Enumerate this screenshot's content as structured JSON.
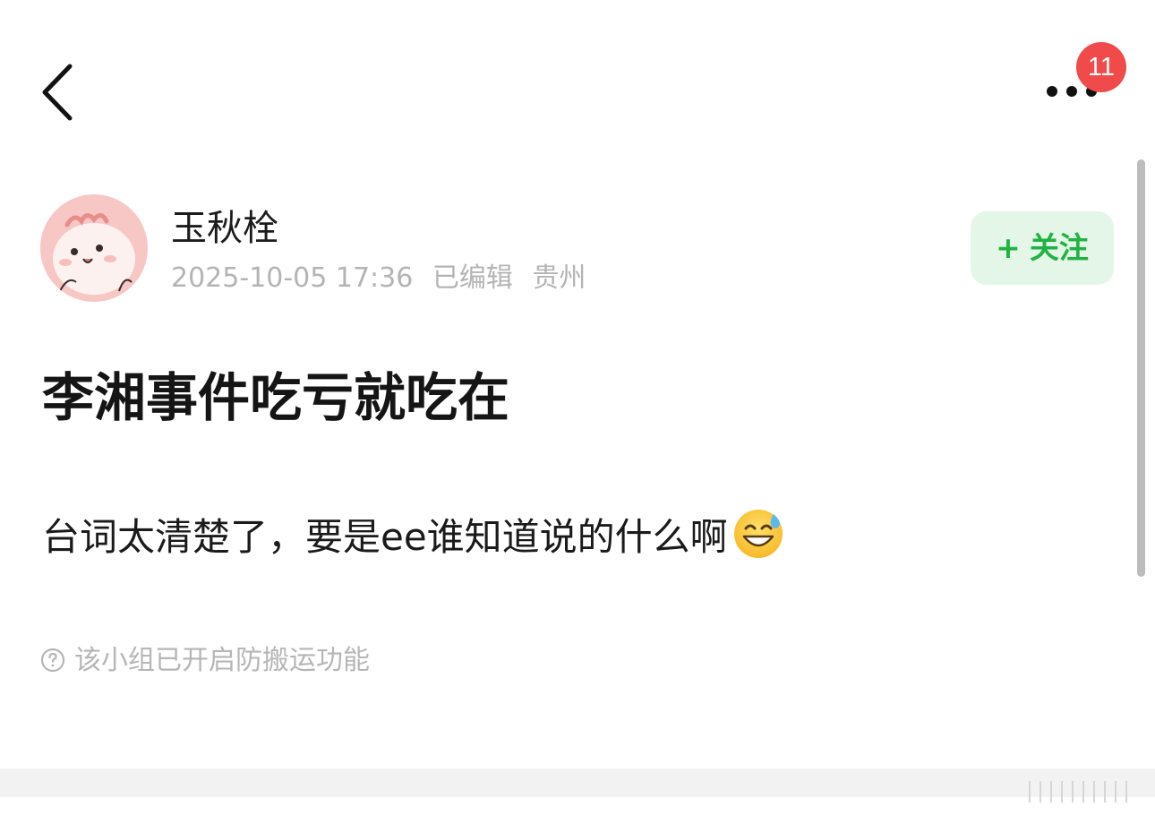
{
  "header": {
    "back_icon": "chevron-left-icon",
    "more_icon": "ellipsis-icon",
    "notification_count": "11",
    "badge_color": "#f04a4a"
  },
  "author": {
    "name": "玉秋栓",
    "avatar_icon": "cartoon-avatar",
    "date": "2025-10-05 17:36",
    "edited_label": "已编辑",
    "location": "贵州"
  },
  "follow": {
    "plus": "+",
    "label": "关注",
    "color": "#1fb341",
    "background": "#e3f6e7"
  },
  "post": {
    "title": "李湘事件吃亏就吃在",
    "body": "台词太清楚了，要是ee谁知道说的什么啊",
    "emoji_icon": "grinning-sweat-emoji-icon"
  },
  "notice": {
    "icon": "question-circle-icon",
    "text": "该小组已开启防搬运功能"
  }
}
